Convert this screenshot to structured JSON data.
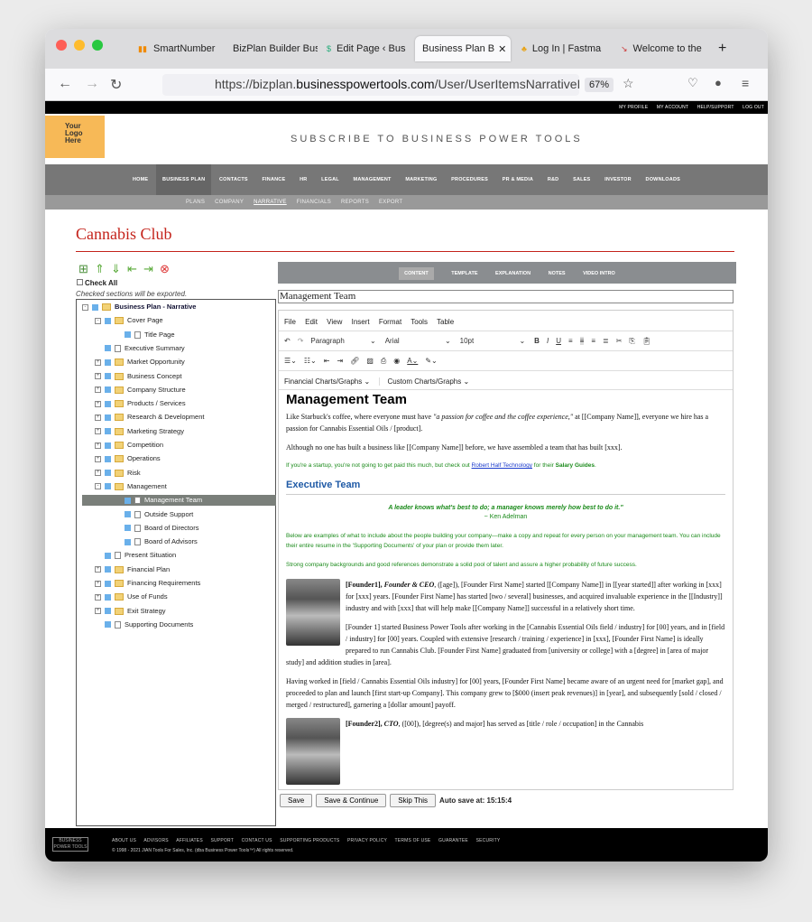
{
  "browser": {
    "tabs": [
      {
        "label": "SmartNumber",
        "icon": "bars-icon"
      },
      {
        "label": "BizPlan Builder Bus",
        "icon": "none"
      },
      {
        "label": "Edit Page ‹ Bus",
        "icon": "dollar-icon"
      },
      {
        "label": "Business Plan B",
        "icon": "none",
        "active": true
      },
      {
        "label": "Log In | Fastma",
        "icon": "users-icon"
      },
      {
        "label": "Welcome to the",
        "icon": "pin-icon"
      }
    ],
    "url_prefix": "https://bizplan.",
    "url_host": "businesspowertools.com",
    "url_path": "/User/UserItemsNarrativeIl.as",
    "zoom": "67%"
  },
  "site": {
    "top_links": [
      "MY PROFILE",
      "MY ACCOUNT",
      "HELP/SUPPORT",
      "LOG OUT"
    ],
    "logo_text": [
      "Your",
      "Logo",
      "Here"
    ],
    "tagline": "SUBSCRIBE TO BUSINESS POWER TOOLS",
    "main_nav": [
      "HOME",
      "BUSINESS PLAN",
      "CONTACTS",
      "FINANCE",
      "HR",
      "LEGAL",
      "MANAGEMENT",
      "MARKETING",
      "PROCEDURES",
      "PR & MEDIA",
      "R&D",
      "SALES",
      "INVESTOR",
      "DOWNLOADS"
    ],
    "main_nav_active": "BUSINESS PLAN",
    "sub_nav": [
      "PLANS",
      "COMPANY",
      "NARRATIVE",
      "FINANCIALS",
      "REPORTS",
      "EXPORT"
    ],
    "sub_nav_active": "NARRATIVE"
  },
  "page": {
    "title": "Cannabis Club"
  },
  "sidebar": {
    "check_all": "Check All",
    "note": "Checked sections will be exported.",
    "tree": [
      {
        "label": "Business Plan - Narrative",
        "level": 0,
        "type": "root",
        "bold": true
      },
      {
        "label": "Cover Page",
        "level": 1,
        "type": "folder",
        "expander": "-"
      },
      {
        "label": "Title Page",
        "level": 2,
        "type": "doc"
      },
      {
        "label": "Executive Summary",
        "level": 1,
        "type": "doc"
      },
      {
        "label": "Market Opportunity",
        "level": 1,
        "type": "folder",
        "expander": "+"
      },
      {
        "label": "Business Concept",
        "level": 1,
        "type": "folder",
        "expander": "+"
      },
      {
        "label": "Company Structure",
        "level": 1,
        "type": "folder",
        "expander": "+"
      },
      {
        "label": "Products / Services",
        "level": 1,
        "type": "folder",
        "expander": "+"
      },
      {
        "label": "Research & Development",
        "level": 1,
        "type": "folder",
        "expander": "+"
      },
      {
        "label": "Marketing Strategy",
        "level": 1,
        "type": "folder",
        "expander": "+"
      },
      {
        "label": "Competition",
        "level": 1,
        "type": "folder",
        "expander": "+"
      },
      {
        "label": "Operations",
        "level": 1,
        "type": "folder",
        "expander": "+"
      },
      {
        "label": "Risk",
        "level": 1,
        "type": "folder",
        "expander": "+"
      },
      {
        "label": "Management",
        "level": 1,
        "type": "folder",
        "expander": "-"
      },
      {
        "label": "Management Team",
        "level": 2,
        "type": "doc",
        "selected": true
      },
      {
        "label": "Outside Support",
        "level": 2,
        "type": "doc"
      },
      {
        "label": "Board of Directors",
        "level": 2,
        "type": "doc"
      },
      {
        "label": "Board of Advisors",
        "level": 2,
        "type": "doc"
      },
      {
        "label": "Present Situation",
        "level": 1,
        "type": "doc"
      },
      {
        "label": "Financial Plan",
        "level": 1,
        "type": "folder",
        "expander": "+"
      },
      {
        "label": "Financing Requirements",
        "level": 1,
        "type": "folder",
        "expander": "+"
      },
      {
        "label": "Use of Funds",
        "level": 1,
        "type": "folder",
        "expander": "+"
      },
      {
        "label": "Exit Strategy",
        "level": 1,
        "type": "folder",
        "expander": "+"
      },
      {
        "label": "Supporting Documents",
        "level": 1,
        "type": "doc"
      }
    ]
  },
  "tabs": [
    "CONTENT",
    "TEMPLATE",
    "EXPLANATION",
    "NOTES",
    "VIDEO INTRO"
  ],
  "tabs_active": "CONTENT",
  "section_title": "Management Team",
  "editor": {
    "menu": [
      "File",
      "Edit",
      "View",
      "Insert",
      "Format",
      "Tools",
      "Table"
    ],
    "block_format": "Paragraph",
    "font": "Arial",
    "font_size": "10pt",
    "custom_menu": [
      "Financial Charts/Graphs",
      "Custom Charts/Graphs"
    ]
  },
  "doc": {
    "h1": "Management Team",
    "p1a": "Like Starbuck's coffee, where everyone must have ",
    "p1b": "\"a passion for coffee and the coffee experience,\"",
    "p1c": " at [[Company Name]], everyone we hire has a passion for Cannabis Essential Oils / [product].",
    "p2": "Although no one has built a business like [[Company Name]] before, we have assembled a team that has built [xxx].",
    "g1a": "If you're a startup, you're not going to get paid this much, but check out ",
    "g1link": "Robert Half Technology",
    "g1b": " for their ",
    "g1c": "Salary Guides",
    "g1d": ".",
    "h2": "Executive Team",
    "quote": "A leader knows what's best to do; a manager knows merely how best to do it.\"",
    "quote_author": "~ Ken Adelman",
    "g2": "Below are examples of what to include about the people building your company—make a copy and repeat for every person on your management team. You can include their entire resume in the 'Supporting Documents' of your plan or provide them later.",
    "g3": "Strong company backgrounds and good references demonstrate a solid pool of talent and assure a higher probability of future success.",
    "f1a": "[Founder1], ",
    "f1b": "Founder & CEO",
    "f1c": ", ([age]), [Founder First Name] started [[Company Name]] in [[year started]] after working in [xxx] for [xxx] years. [Founder First Name] has started [two / several] businesses, and acquired invaluable experience in the [[Industry]] industry and with [xxx] that will help make [[Company Name]] successful in a relatively short time.",
    "f1p2": "[Founder 1] started Business Power Tools after working in the [Cannabis Essential Oils field / industry] for [00] years, and in [field / industry] for [00] years. Coupled with extensive [research / training / experience] in [xxx], [Founder First Name] is ideally prepared to run Cannabis Club. [Founder First Name] graduated from [university or college] with a [degree] in [area of major study] and addition studies in [area].",
    "p3": "Having worked in [field / Cannabis Essential Oils industry] for [00] years, [Founder First Name] became aware of an urgent need for [market gap], and proceeded to plan and launch [first start-up Company]. This company grew to [$000 (insert peak revenues)] in [year], and subsequently [sold / closed / merged / restructured], garnering a [dollar amount] payoff.",
    "f2a": "[Founder2], ",
    "f2b": "CTO",
    "f2c": ", ([00]), [degree(s) and major] has served as [title / role / occupation] in the Cannabis"
  },
  "buttons": {
    "save": "Save",
    "save_continue": "Save & Continue",
    "skip": "Skip This"
  },
  "autosave": "Auto save at: 15:15:4",
  "footer": {
    "links": [
      "ABOUT US",
      "ADVISORS",
      "AFFILIATES",
      "SUPPORT",
      "CONTACT US",
      "SUPPORTING PRODUCTS",
      "PRIVACY POLICY",
      "TERMS OF USE",
      "GUARANTEE",
      "SECURITY"
    ],
    "copyright": "© 1998 - 2021 JIAN Tools For Sales, Inc. (dba Business Power Tools™) All rights reserved.",
    "logo": "BUSINESS POWER TOOLS"
  }
}
